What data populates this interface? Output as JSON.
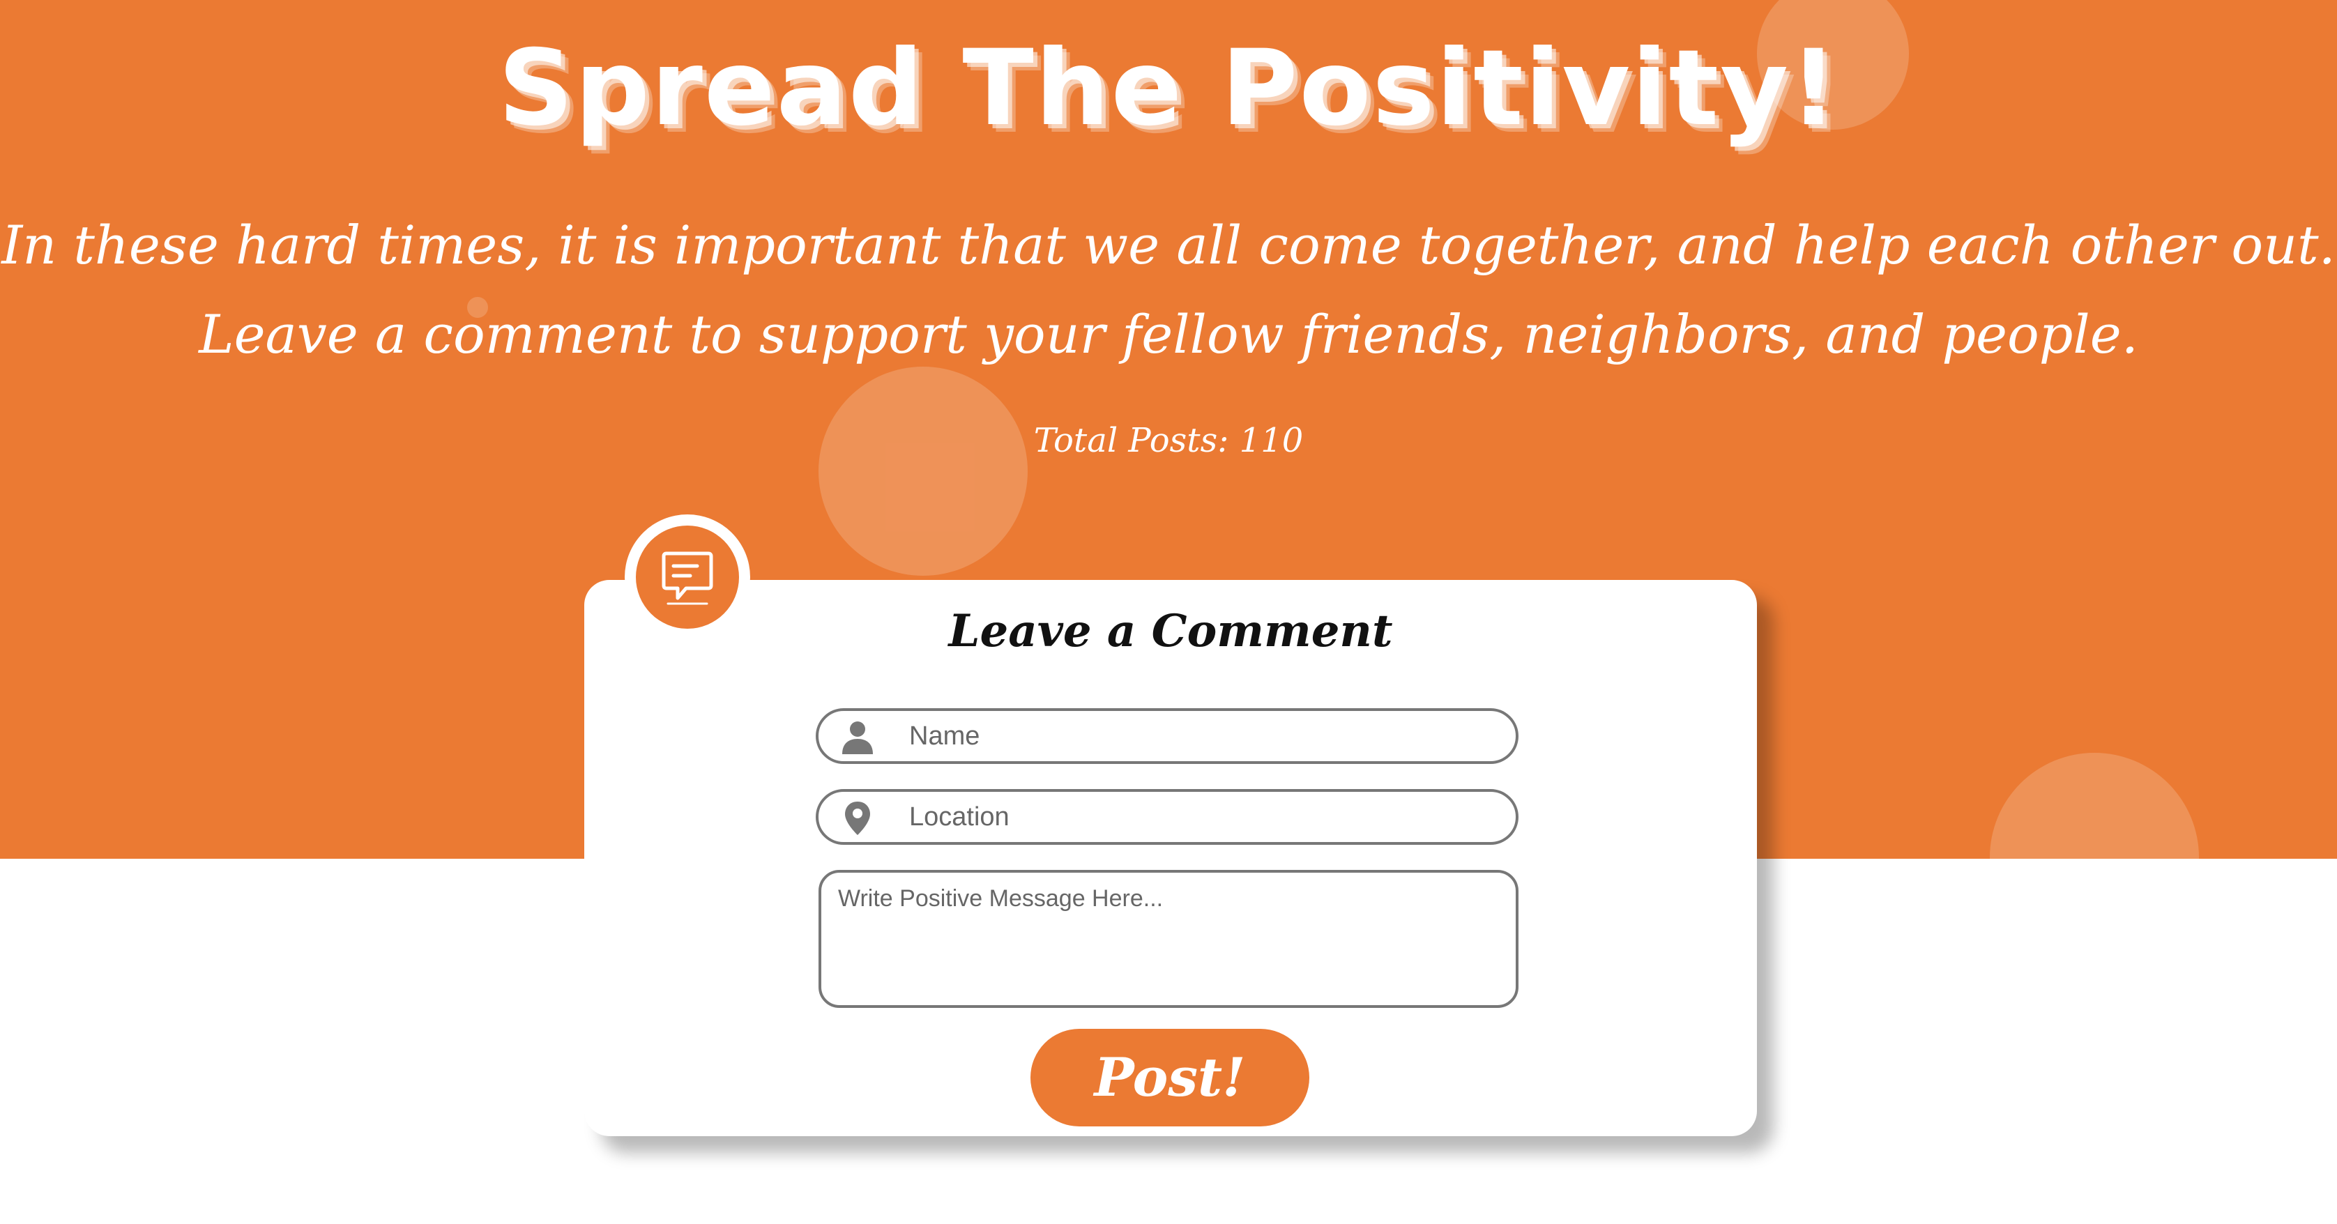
{
  "colors": {
    "accent": "#EB7A33",
    "text_dark": "#111111",
    "field_border": "#777777",
    "placeholder": "#666666"
  },
  "header": {
    "title": "Spread The Positivity!",
    "subtitle_line1": "In these hard times, it is important that we all come together, and help each other out.",
    "subtitle_line2": "Leave a comment to support your fellow friends, neighbors, and people.",
    "total_posts": "Total Posts: 110"
  },
  "comment_form": {
    "icon": "chat-bubble-icon",
    "title": "Leave a Comment",
    "name_placeholder": "Name",
    "name_icon": "user-icon",
    "location_placeholder": "Location",
    "location_icon": "map-pin-icon",
    "message_placeholder": "Write Positive Message Here...",
    "post_label": "Post!"
  }
}
